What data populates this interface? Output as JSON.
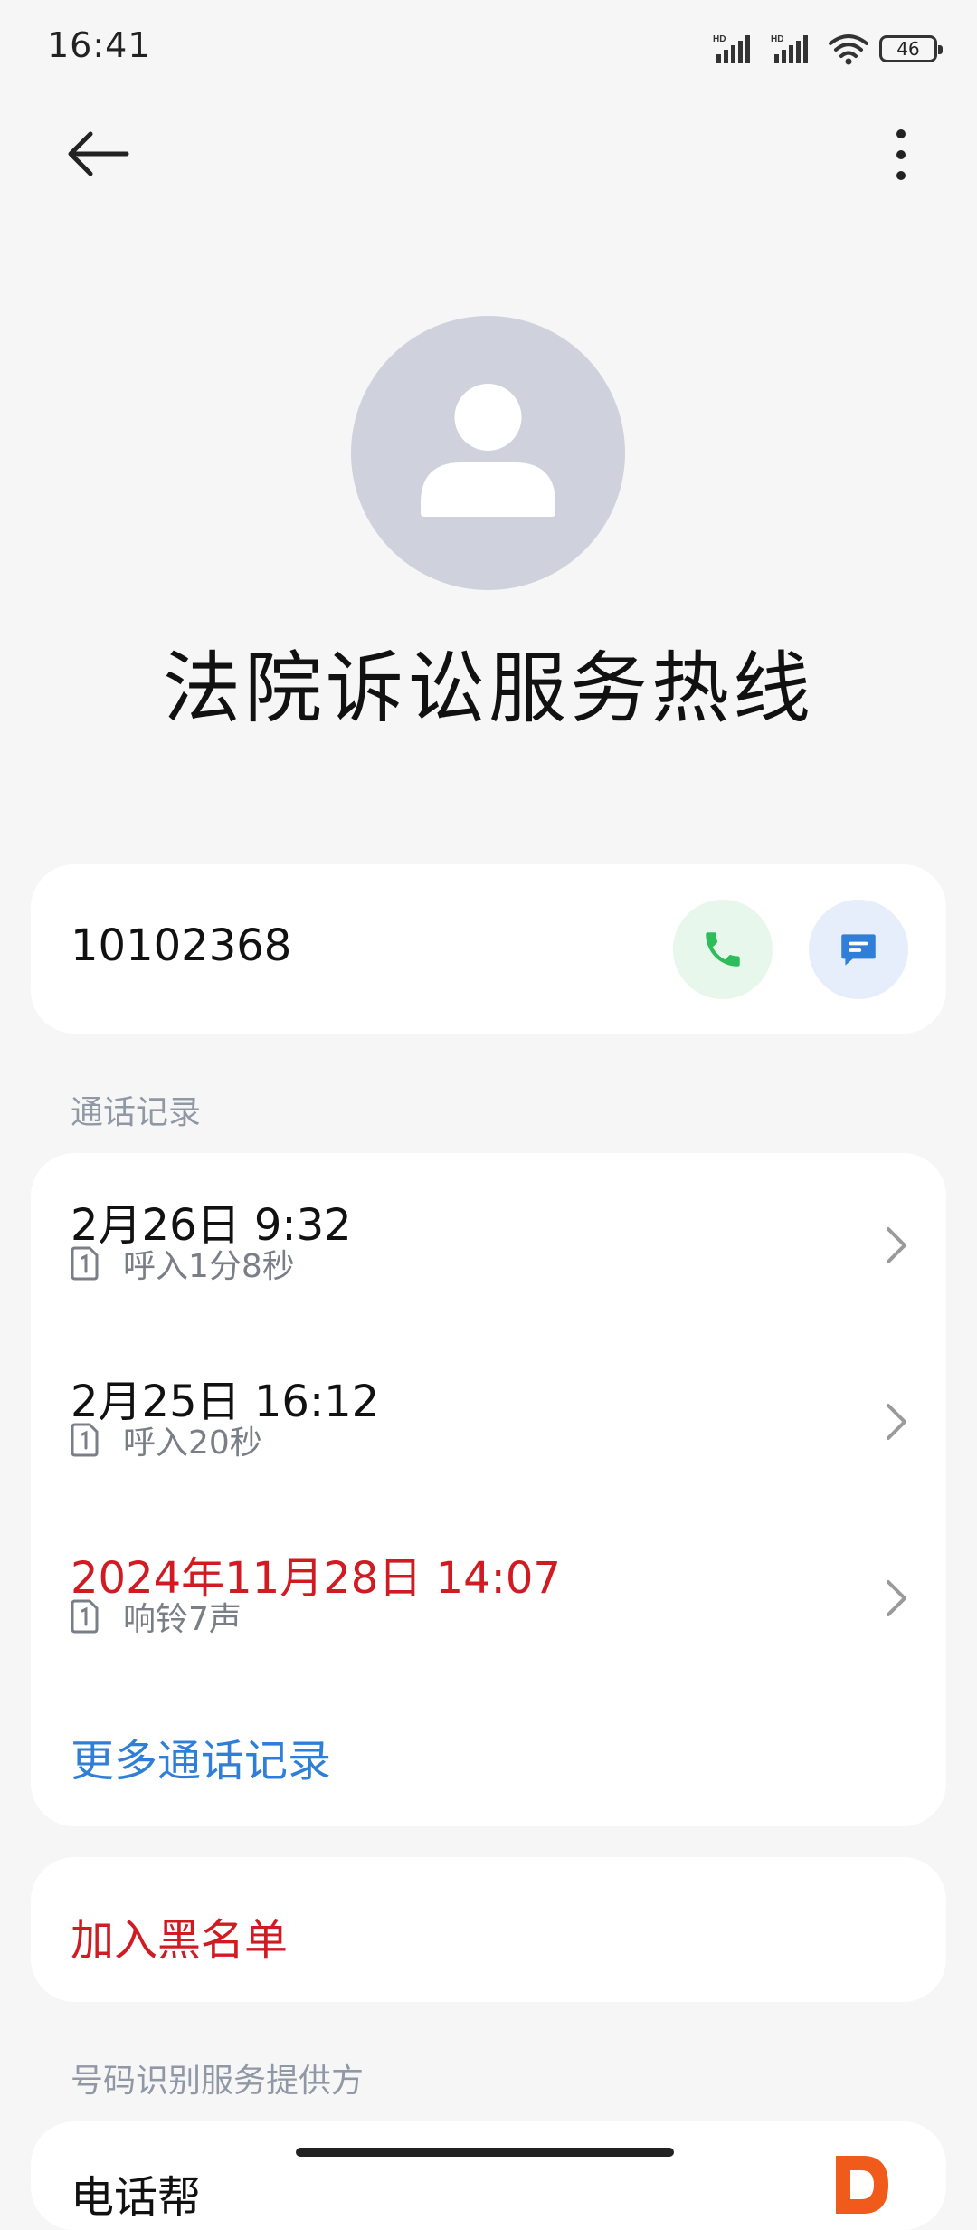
{
  "status_bar": {
    "time": "16:41",
    "battery": "46",
    "icons": [
      "hd-signal-1-icon",
      "hd-signal-2-icon",
      "wifi-icon",
      "battery-icon"
    ]
  },
  "top_bar": {
    "back_icon": "back-arrow-icon",
    "more_icon": "more-vertical-icon"
  },
  "contact": {
    "name": "法院诉讼服务热线",
    "avatar_icon": "person-icon",
    "number": "10102368",
    "call_icon": "phone-icon",
    "message_icon": "message-icon"
  },
  "call_log": {
    "section_title": "通话记录",
    "entries": [
      {
        "datetime": "2月26日 9:32",
        "detail": "呼入1分8秒",
        "missed": false
      },
      {
        "datetime": "2月25日 16:12",
        "detail": "呼入20秒",
        "missed": false
      },
      {
        "datetime": "2024年11月28日 14:07",
        "detail": "响铃7声",
        "missed": true
      }
    ],
    "more_label": "更多通话记录"
  },
  "actions": {
    "block_label": "加入黑名单"
  },
  "provider": {
    "section_title": "号码识别服务提供方",
    "name": "电话帮"
  },
  "colors": {
    "background": "#f6f6f6",
    "missed_red": "#d01b23",
    "link_blue": "#2f7fd8",
    "call_green": "#2dbd5a",
    "message_blue": "#2f7fd8",
    "avatar_gray": "#cfd2dd"
  }
}
